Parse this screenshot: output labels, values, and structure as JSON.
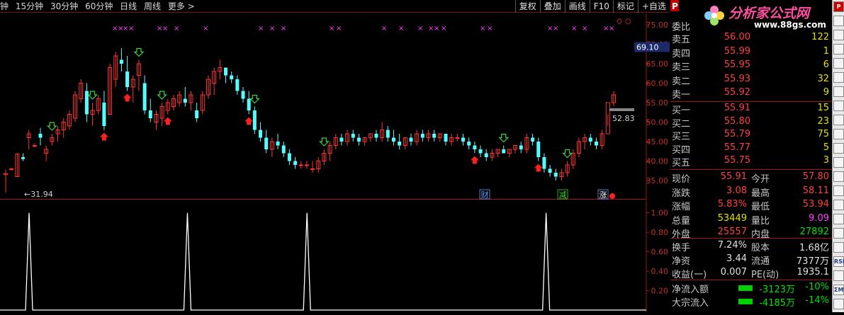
{
  "toolbar": {
    "periods": [
      "钟",
      "15分钟",
      "30分钟",
      "60分钟",
      "日线",
      "周线",
      "更多 >"
    ],
    "buttons": [
      "复权",
      "叠加",
      "画线",
      "F10",
      "标记",
      "+自选"
    ]
  },
  "chart_data": {
    "type": "candlestick",
    "price_axis": {
      "ticks": [
        "75.00",
        "70.00",
        "65.00",
        "60.00",
        "55.00",
        "50.00",
        "45.00",
        "40.00",
        "35.00"
      ],
      "ylim": [
        31,
        77
      ]
    },
    "current_price_box": "69.10",
    "last_price_label": "52.83",
    "low_label": "←31.94",
    "candles": [
      [
        36.5,
        37.8,
        31.9,
        36.8
      ],
      [
        38,
        38.2,
        37.5,
        38
      ],
      [
        36,
        42,
        36,
        41.8
      ],
      [
        41,
        42,
        40,
        40.5
      ],
      [
        46,
        48,
        43,
        47
      ],
      [
        44,
        44.5,
        43.5,
        44
      ],
      [
        47,
        48.5,
        44,
        46
      ],
      [
        42,
        44,
        40,
        43
      ],
      [
        45,
        47,
        44,
        46
      ],
      [
        47,
        49,
        45,
        48
      ],
      [
        48,
        51,
        46,
        50
      ],
      [
        49,
        53,
        48,
        52
      ],
      [
        51,
        58,
        50,
        57
      ],
      [
        56,
        61,
        55,
        60
      ],
      [
        58,
        60,
        50,
        52
      ],
      [
        52,
        55,
        49,
        53
      ],
      [
        53,
        57,
        52,
        56
      ],
      [
        55,
        58,
        48,
        49
      ],
      [
        52,
        65,
        52,
        64
      ],
      [
        61,
        68,
        59,
        67
      ],
      [
        66,
        69,
        63,
        65
      ],
      [
        63,
        67,
        58,
        59
      ],
      [
        59,
        62,
        55,
        61
      ],
      [
        62,
        66,
        58,
        65
      ],
      [
        60,
        62,
        52,
        53
      ],
      [
        53,
        56,
        50,
        51
      ],
      [
        50,
        53,
        48,
        52
      ],
      [
        51,
        55,
        49,
        54
      ],
      [
        53,
        56,
        52,
        55
      ],
      [
        54,
        57,
        53,
        56
      ],
      [
        55,
        58,
        54,
        57
      ],
      [
        56,
        59,
        54,
        55
      ],
      [
        55,
        58,
        53,
        57
      ],
      [
        53,
        55,
        50,
        51
      ],
      [
        53,
        58,
        52,
        57
      ],
      [
        57,
        62,
        56,
        61
      ],
      [
        60,
        64,
        57,
        63
      ],
      [
        63,
        66,
        61,
        64
      ],
      [
        64,
        64,
        60,
        62
      ],
      [
        62,
        63,
        60,
        61
      ],
      [
        61,
        62,
        57,
        58
      ],
      [
        58,
        59,
        55,
        56
      ],
      [
        56,
        58,
        52,
        53
      ],
      [
        53,
        54,
        47,
        48
      ],
      [
        48,
        50,
        45,
        46
      ],
      [
        46,
        48,
        42,
        43
      ],
      [
        43,
        46,
        41,
        45
      ],
      [
        45,
        47,
        43,
        44
      ],
      [
        44,
        45,
        41,
        42
      ],
      [
        42,
        43,
        39,
        40
      ],
      [
        40,
        41,
        38,
        39
      ],
      [
        39,
        40,
        38,
        39
      ],
      [
        39,
        40,
        38,
        39
      ],
      [
        38,
        40,
        37,
        38
      ],
      [
        38,
        41,
        37,
        40
      ],
      [
        40,
        43,
        39,
        42
      ],
      [
        42,
        45,
        40,
        44
      ],
      [
        44,
        47,
        43,
        46
      ],
      [
        46,
        47,
        44,
        45
      ],
      [
        45,
        48,
        44,
        47
      ],
      [
        47,
        48,
        45,
        46
      ],
      [
        46,
        47,
        44,
        45
      ],
      [
        45,
        46,
        44,
        46
      ],
      [
        46,
        47,
        45,
        47
      ],
      [
        47,
        48,
        45,
        46
      ],
      [
        46,
        50,
        45,
        48
      ],
      [
        48,
        49,
        45,
        46
      ],
      [
        46,
        48,
        44,
        45
      ],
      [
        45,
        47,
        43,
        44
      ],
      [
        44,
        46,
        43,
        46
      ],
      [
        46,
        47,
        44,
        45
      ],
      [
        45,
        48,
        44,
        47
      ],
      [
        47,
        48,
        45,
        46
      ],
      [
        46,
        48,
        45,
        47
      ],
      [
        47,
        48,
        45,
        46
      ],
      [
        46,
        47,
        45,
        47
      ],
      [
        47,
        47,
        44,
        45
      ],
      [
        45,
        47,
        44,
        46
      ],
      [
        46,
        47,
        45,
        46
      ],
      [
        46,
        47,
        44,
        45
      ],
      [
        45,
        46,
        43,
        44
      ],
      [
        44,
        45,
        42,
        43
      ],
      [
        43,
        44,
        41,
        42
      ],
      [
        42,
        43,
        40,
        41
      ],
      [
        41,
        43,
        40,
        42
      ],
      [
        42,
        43,
        41,
        43
      ],
      [
        43,
        44,
        42,
        42
      ],
      [
        42,
        43,
        41,
        43
      ],
      [
        43,
        44,
        42,
        44
      ],
      [
        44,
        45,
        42,
        43
      ],
      [
        43,
        47,
        42,
        46
      ],
      [
        46,
        47,
        44,
        45
      ],
      [
        45,
        46,
        40,
        41
      ],
      [
        41,
        42,
        37,
        38
      ],
      [
        38,
        39,
        36,
        37
      ],
      [
        37,
        38,
        35,
        36
      ],
      [
        36,
        38,
        35,
        37
      ],
      [
        37,
        40,
        36,
        39
      ],
      [
        39,
        43,
        38,
        42
      ],
      [
        42,
        46,
        41,
        45
      ],
      [
        45,
        47,
        43,
        46
      ],
      [
        46,
        47,
        44,
        45
      ],
      [
        45,
        46,
        43,
        44
      ],
      [
        44,
        48,
        43,
        47
      ],
      [
        47,
        49,
        52,
        55
      ],
      [
        55,
        58,
        54,
        57
      ]
    ],
    "markers": {
      "green_down": [
        8,
        15,
        23,
        27,
        43,
        55,
        86,
        97
      ],
      "red_up": [
        17,
        21,
        28,
        42,
        81,
        92
      ]
    },
    "event_labels": [
      "财",
      "减",
      "涨"
    ],
    "indicator": {
      "ticks": [
        "1.00",
        "0.80",
        "0.60",
        "0.40",
        "0.20"
      ],
      "ylim": [
        0,
        1.1
      ],
      "spikes_at_fraction": [
        0.045,
        0.29,
        0.475,
        0.845
      ]
    }
  },
  "quote": {
    "weibi_label": "委比",
    "asks": [
      {
        "label": "卖五",
        "price": "56.00",
        "vol": "122"
      },
      {
        "label": "卖四",
        "price": "55.99",
        "vol": "1"
      },
      {
        "label": "卖三",
        "price": "55.95",
        "vol": "6"
      },
      {
        "label": "卖二",
        "price": "55.93",
        "vol": "32"
      },
      {
        "label": "卖一",
        "price": "55.92",
        "vol": "9"
      }
    ],
    "bids": [
      {
        "label": "买一",
        "price": "55.91",
        "vol": "15"
      },
      {
        "label": "买二",
        "price": "55.80",
        "vol": "23"
      },
      {
        "label": "买三",
        "price": "55.79",
        "vol": "75"
      },
      {
        "label": "买四",
        "price": "55.77",
        "vol": "5"
      },
      {
        "label": "买五",
        "price": "55.75",
        "vol": "3"
      }
    ],
    "stats": [
      {
        "l1": "现价",
        "v1": "55.91",
        "c1": "red",
        "l2": "今开",
        "v2": "57.80",
        "c2": "red"
      },
      {
        "l1": "涨跌",
        "v1": "3.08",
        "c1": "red",
        "l2": "最高",
        "v2": "58.11",
        "c2": "red"
      },
      {
        "l1": "涨幅",
        "v1": "5.83%",
        "c1": "red",
        "l2": "最低",
        "v2": "53.94",
        "c2": "red"
      },
      {
        "l1": "总量",
        "v1": "53449",
        "c1": "yellow",
        "l2": "量比",
        "v2": "9.09",
        "c2": "magenta"
      },
      {
        "l1": "外盘",
        "v1": "25557",
        "c1": "red",
        "l2": "内盘",
        "v2": "27892",
        "c2": "green"
      }
    ],
    "stats2": [
      {
        "l1": "换手",
        "v1": "7.24%",
        "l2": "股本",
        "v2": "1.68亿"
      },
      {
        "l1": "净资",
        "v1": "3.44",
        "l2": "流通",
        "v2": "7377万"
      },
      {
        "l1": "收益(一)",
        "v1": "0.007",
        "l2": "PE(动)",
        "v2": "1935.1"
      }
    ],
    "flows": [
      {
        "label": "净流入额",
        "amt": "-3123万",
        "pct": "-10%"
      },
      {
        "label": "大宗流入",
        "amt": "-4185万",
        "pct": "-14%"
      }
    ],
    "logo_text": "分析家公式网",
    "logo_url": "www.88gs.com"
  },
  "sidebar": [
    "P",
    "RSI",
    "ΣM"
  ]
}
